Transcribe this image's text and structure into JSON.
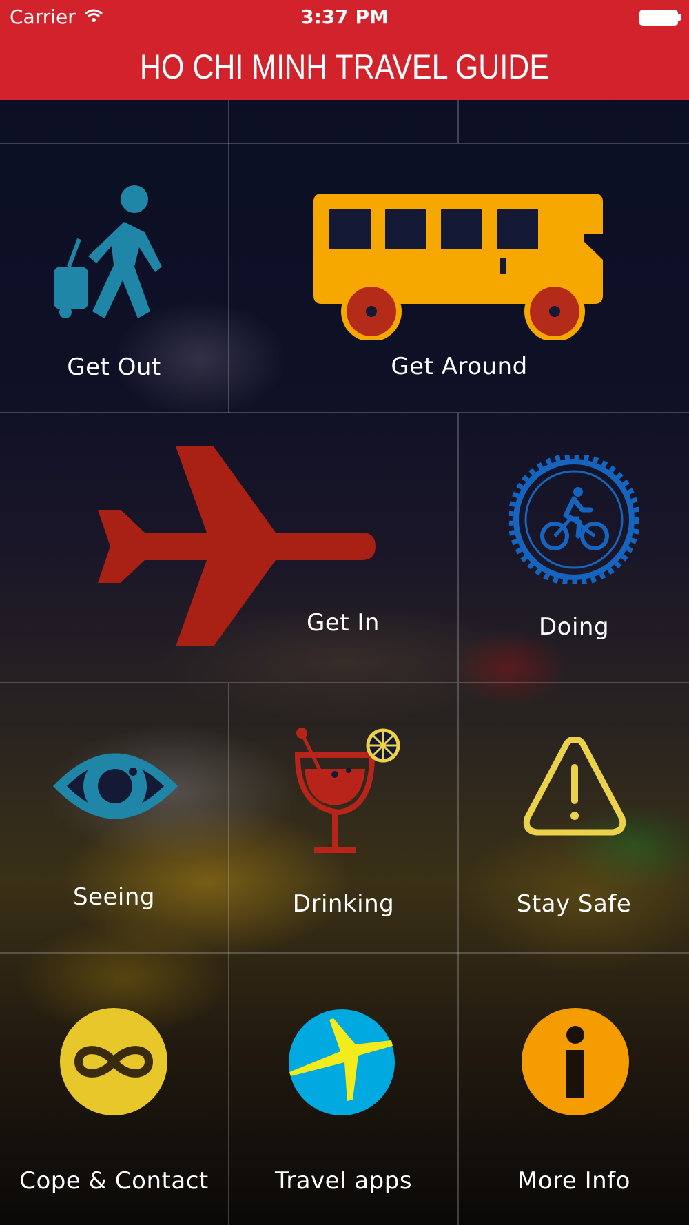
{
  "status_bar": {
    "carrier": "Carrier",
    "time": "3:37 PM",
    "icons": [
      "wifi-icon",
      "battery-icon"
    ]
  },
  "header": {
    "title": "HO CHI MINH TRAVEL GUIDE",
    "background_color": "#d2232c"
  },
  "menu": {
    "get_out": {
      "label": "Get Out",
      "icon": "walking-traveler-icon",
      "color": "#1f86a8"
    },
    "get_around": {
      "label": "Get Around",
      "icon": "bus-icon",
      "color": "#f7a800"
    },
    "get_in": {
      "label": "Get In",
      "icon": "airplane-icon",
      "color": "#a92015"
    },
    "doing": {
      "label": "Doing",
      "icon": "bicycle-gear-icon",
      "color": "#1565c0"
    },
    "seeing": {
      "label": "Seeing",
      "icon": "eye-icon",
      "color": "#1f86a8"
    },
    "drinking": {
      "label": "Drinking",
      "icon": "cocktail-icon",
      "color": "#b8241a"
    },
    "stay_safe": {
      "label": "Stay Safe",
      "icon": "warning-icon",
      "color": "#ecd24a"
    },
    "cope_contact": {
      "label": "Cope & Contact",
      "icon": "infinity-icon",
      "color": "#e8c72a"
    },
    "travel_apps": {
      "label": "Travel apps",
      "icon": "expedia-plane-icon",
      "color": "#00a9e0"
    },
    "more_info": {
      "label": "More Info",
      "icon": "info-icon",
      "color": "#f59c00"
    }
  }
}
